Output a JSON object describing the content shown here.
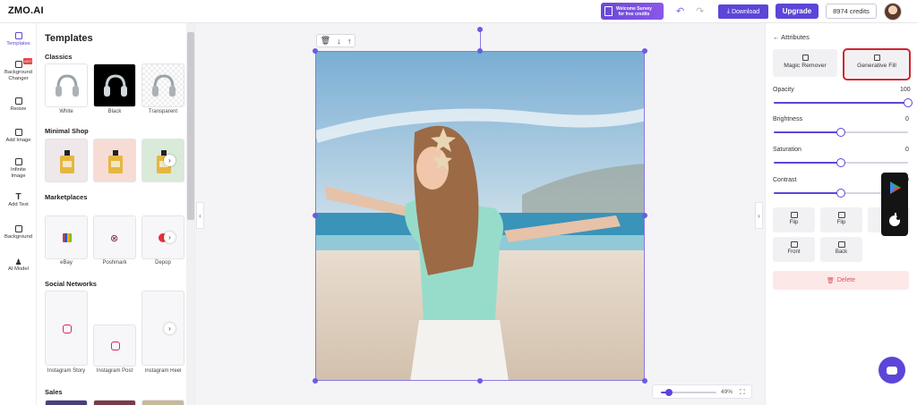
{
  "header": {
    "logo": "ZMO.AI",
    "survey_line1": "Welcome Survey",
    "survey_line2": "for free credits",
    "download_label": "Download",
    "upgrade_label": "Upgrade",
    "credits": "8974 credits"
  },
  "leftnav": {
    "items": [
      {
        "label": "Templates"
      },
      {
        "label": "Background Changer",
        "badge": "HOT"
      },
      {
        "label": "Resize"
      },
      {
        "label": "Add Image"
      },
      {
        "label": "Infinite Image"
      },
      {
        "label": "Add Text"
      },
      {
        "label": "Background"
      },
      {
        "label": "AI Model"
      }
    ]
  },
  "templates": {
    "title": "Templates",
    "sections": {
      "classics": "Classics",
      "minimal_shop": "Minimal Shop",
      "marketplaces": "Marketplaces",
      "social": "Social Networks",
      "sales": "Sales"
    },
    "classics": [
      "White",
      "Black",
      "Transparent"
    ],
    "marketplaces": [
      "eBay",
      "Poshmark",
      "Depop"
    ],
    "social": [
      "Instagram Story",
      "Instagram Post",
      "Instagram Reel"
    ]
  },
  "canvas": {
    "zoom": "49%",
    "zoom_fraction": 0.15
  },
  "attributes": {
    "back_label": "Attributes",
    "magic_remover": "Magic Remover",
    "generative_fill": "Generative Fill",
    "sliders": [
      {
        "label": "Opacity",
        "value": "100",
        "fraction": 1.0
      },
      {
        "label": "Brightness",
        "value": "0",
        "fraction": 0.5
      },
      {
        "label": "Saturation",
        "value": "0",
        "fraction": 0.5
      },
      {
        "label": "Contrast",
        "value": "0",
        "fraction": 0.5
      }
    ],
    "flip_labels": [
      "Flip",
      "Flip",
      "Du"
    ],
    "order_labels": [
      "Front",
      "Back"
    ],
    "delete_label": "Delete"
  },
  "colors": {
    "accent": "#5b46d8",
    "highlight": "#d0242a",
    "delete_bg": "#fde8e8"
  }
}
